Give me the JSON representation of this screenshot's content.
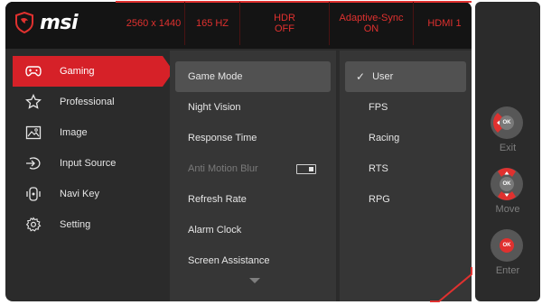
{
  "brand": {
    "logo_text": "msi"
  },
  "status_bar": [
    {
      "text": "2560 x 1440"
    },
    {
      "text": "165 HZ"
    },
    {
      "text": "HDR\nOFF"
    },
    {
      "text": "Adaptive-Sync\nON"
    },
    {
      "text": "HDMI 1"
    }
  ],
  "main_menu": [
    {
      "label": "Gaming",
      "icon": "gamepad-icon"
    },
    {
      "label": "Professional",
      "icon": "star-icon"
    },
    {
      "label": "Image",
      "icon": "image-icon"
    },
    {
      "label": "Input Source",
      "icon": "input-source-icon"
    },
    {
      "label": "Navi Key",
      "icon": "navi-key-icon"
    },
    {
      "label": "Setting",
      "icon": "gear-icon"
    }
  ],
  "sub_menu": [
    {
      "label": "Game Mode"
    },
    {
      "label": "Night Vision"
    },
    {
      "label": "Response Time"
    },
    {
      "label": "Anti Motion Blur"
    },
    {
      "label": "Refresh Rate"
    },
    {
      "label": "Alarm Clock"
    },
    {
      "label": "Screen Assistance"
    }
  ],
  "options": [
    {
      "label": "User"
    },
    {
      "label": "FPS"
    },
    {
      "label": "Racing"
    },
    {
      "label": "RTS"
    },
    {
      "label": "RPG"
    }
  ],
  "nav": {
    "exit_label": "Exit",
    "move_label": "Move",
    "enter_label": "Enter",
    "center_text_exit": "OK",
    "center_text_move": "OK",
    "center_text_enter": "OK"
  },
  "colors": {
    "accent": "#d62128",
    "panel": "#363636",
    "header": "#141414"
  }
}
